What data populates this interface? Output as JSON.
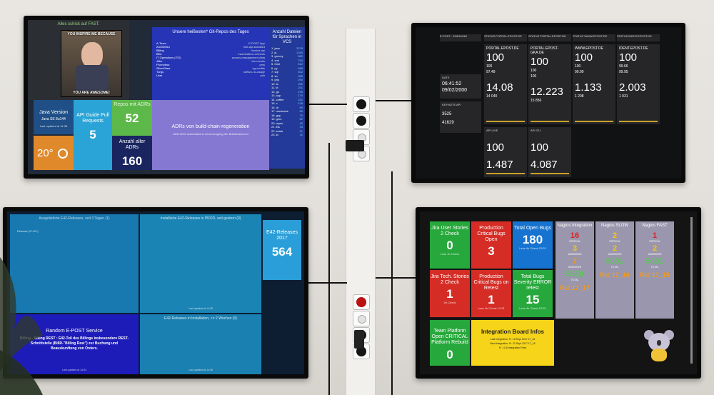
{
  "tv1": {
    "meme_caption": "Alles schick auf FAST.",
    "meme_top": "YOU INSPIRE ME BECAUSE",
    "meme_bottom": "YOU ARE AWESOME!",
    "repos_title": "Unsere heißesten* Git-Repos des Tages",
    "repos_left": [
      "A-Team",
      "Architektur",
      "Billing",
      "Blitz",
      "IT Operations (ITO)",
      "Jitter",
      "Promoteur",
      "SilverStars",
      "Turgu",
      "User"
    ],
    "repos_right": [
      "E-POST App",
      "rest-api-standard",
      "invoice-api",
      "mail-mailbox-recheck",
      "access-management-data",
      "bio-results",
      "pms",
      "ng-credits",
      "softarc-no-usage",
      "pcb"
    ],
    "vcs_title": "Anzahl Dateien für Sprachen in VCS",
    "vcs_rows": [
      [
        "1. java",
        "3278"
      ],
      [
        "2. js",
        "1240"
      ],
      [
        "3. groovy",
        "882"
      ],
      [
        "4. xml",
        "764"
      ],
      [
        "5. html",
        "612"
      ],
      [
        "6. py",
        "488"
      ],
      [
        "7. sql",
        "402"
      ],
      [
        "8. sh",
        "355"
      ],
      [
        "9. php",
        "290"
      ],
      [
        "10. ts",
        "260"
      ],
      [
        "11. kt",
        "231"
      ],
      [
        "12. go",
        "199"
      ],
      [
        "13. cpp",
        "170"
      ],
      [
        "14. coffee",
        "151"
      ],
      [
        "15. c",
        "128"
      ],
      [
        "16. rb",
        "99"
      ],
      [
        "17. mustache",
        "85"
      ],
      [
        "18. gsp",
        "70"
      ],
      [
        "19. gem",
        "52"
      ],
      [
        "20. rsyso",
        "40"
      ],
      [
        "21. kts",
        "33"
      ],
      [
        "22. scala",
        "21"
      ],
      [
        "23. kt",
        "12"
      ]
    ],
    "java_title": "Java Version",
    "java_value": "Java SE 8u144",
    "temp_value": "20°",
    "api_title": "API Guide Pull Requests",
    "api_value": "5",
    "repos_adr_title": "Repos mit ADRs",
    "repos_adr_value": "52",
    "adr_total_title": "Anzahl aller ADRs",
    "adr_total_value": "160",
    "adr_regen_title": "ADRs von build-chain-regeneration",
    "adr_regen_sub": "ADR-0001 automatische neuerzeugung der Buildchains.md",
    "updated": "Last updated at 11:38"
  },
  "tv2": {
    "col_headers": [
      "E-POST - ENDKUND",
      "STATUS PORTAL.EPOST.DE",
      "STATUS PORTAL.EPOST.DE",
      "STATUS WWW.EPOST.DE",
      "STATUS IDENT.EPOST.DE"
    ],
    "hosts": [
      "PORTAL.EPOST.DE",
      "PORTAL.EPOST-GKA.DE",
      "WWW.EPOST.DE",
      "IDENT.EPOST.DE"
    ],
    "avail": [
      "100",
      "100",
      "100",
      "100"
    ],
    "avail24": [
      "100",
      "100",
      "100",
      "99.66"
    ],
    "avail_week": [
      "97.49",
      "100",
      "99.90",
      "99.95"
    ],
    "perf": [
      "14.08",
      "12.223",
      "1.133",
      "2.003"
    ],
    "perf_prev": [
      "14 040",
      "15 856",
      "1 208",
      "1 031"
    ],
    "date_label": "DATE",
    "time": "06:41:52",
    "date": "09/02/2000",
    "keynote_label": "KEYNOTE API",
    "keynote_a": "3525",
    "keynote_b": "41629",
    "live_headers": [
      "API LIVE",
      "API ITU"
    ],
    "live_avail": [
      "100",
      "100"
    ],
    "live_perf": [
      "1.487",
      "4.087"
    ]
  },
  "tv3": {
    "header_left": "Ausgelieferte E42-Releases, seit 3 Tagen (1)",
    "header_mid": "Installierte E42-Releases in PROD, seit gestern (0)",
    "release_title": "E42-Releases 2017",
    "release_value": "564",
    "row_text": "Release (IC-DC)",
    "random_title": "Random E-POST Service",
    "random_body": "Billing - Billing REST : E42-Teil des Billings insbesondere REST-Schnittstelle (BillR-\"Billing Rest\") zur Buchung und Beauskunftung von Orders.",
    "install_title": "E42-Releases in Installation, <= 2 Wochen (0)",
    "updated": "Last updated at 14:38",
    "updated2": "Last updated at 14:34"
  },
  "tv4": {
    "tiles": [
      {
        "title": "Jira User Stories 2 Check",
        "value": "0",
        "sub": "Less 4h Check",
        "color": "#27a83c"
      },
      {
        "title": "Production Critical Bugs Open",
        "value": "3",
        "sub": "",
        "color": "#d52d26"
      },
      {
        "title": "Total Open Bugs",
        "value": "180",
        "sub": "Less 4h Check 22/23",
        "color": "#1673cf"
      },
      {
        "title": "Jira Tech. Stories 2 Check",
        "value": "1",
        "sub": "4h Check",
        "color": "#d52d26"
      },
      {
        "title": "Production Critical Bugs on Retest",
        "value": "1",
        "sub": "Less 4h Check 1/131",
        "color": "#d52d26"
      },
      {
        "title": "Total Bugs Severity ERROR retest",
        "value": "15",
        "sub": "Less 4h Check 22/23",
        "color": "#27a83c"
      }
    ],
    "nagios": [
      {
        "title": "Nagios Integration",
        "critical": "16",
        "warnings": "3",
        "unknown": "7",
        "total": "5519",
        "rel": "Rel 17_17",
        "crit_color": "#e02020"
      },
      {
        "title": "Nagios SLOW",
        "critical": "2",
        "warnings": "2",
        "unknown": "",
        "total": "5001",
        "rel": "Rel 17_16",
        "crit_color": "#f5c518"
      },
      {
        "title": "Nagios FAST",
        "critical": "1",
        "warnings": "2",
        "unknown": "",
        "total": "5001",
        "rel": "Rel 17_15",
        "crit_color": "#e02020"
      }
    ],
    "labels": {
      "critical": "CRITICAL",
      "warnings": "WARNINGS",
      "unknown": "UNKNOWN",
      "total": "TOTAL"
    },
    "team_title": "Team Platform Open CRITICAL Platform Rebuild",
    "team_value": "0",
    "infos_title": "Integration Board Infos",
    "infos_lines": [
      "Last Integration: Fr. 15 Sept 2017 17_16",
      "Next Integration: Fr. 22 Sept 2017 17_16",
      "Fr. 13-6 Integration Freie"
    ],
    "updated": "Last updated at 14:36"
  }
}
